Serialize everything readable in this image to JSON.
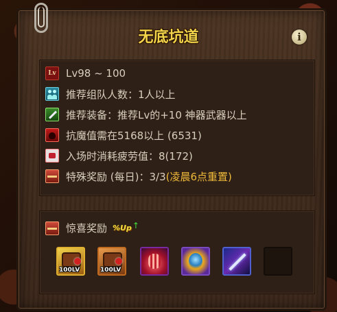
{
  "dungeon": {
    "title": "无底坑道",
    "info_button": "i"
  },
  "info": {
    "rows": [
      {
        "icon": "level-icon",
        "icon_text": "Lv",
        "label": "Lv98 ~ 100",
        "highlight": ""
      },
      {
        "icon": "party-icon",
        "label": "推荐组队人数：1人以上",
        "highlight": ""
      },
      {
        "icon": "weapon-icon",
        "label": "推荐装备：推荐Lv的+10 神器武器以上",
        "highlight": ""
      },
      {
        "icon": "demon-icon",
        "label": "抗魔值需在5168以上 (6531)",
        "highlight": ""
      },
      {
        "icon": "fatigue-icon",
        "label": "入场时消耗疲劳值：8(172)",
        "highlight": ""
      },
      {
        "icon": "chest-icon",
        "label": "特殊奖励 (每日)：3/3",
        "highlight": "(凌晨6点重置)"
      }
    ]
  },
  "surprise": {
    "label": "惊喜奖励",
    "badge": "%Up",
    "badge_arrow": "↑",
    "items": [
      {
        "icon": "exp-box-icon",
        "label": "100LV"
      },
      {
        "icon": "exp-box-icon",
        "label": "100LV"
      },
      {
        "icon": "red-crystal-icon",
        "label": ""
      },
      {
        "icon": "golden-orb-icon",
        "label": ""
      },
      {
        "icon": "purple-shard-icon",
        "label": ""
      },
      {
        "icon": "empty-slot",
        "label": ""
      }
    ]
  },
  "colors": {
    "title": "#f2d34a",
    "text": "#d8cfbe",
    "highlight": "#f0b93a",
    "panel": "#3f2a1c"
  }
}
